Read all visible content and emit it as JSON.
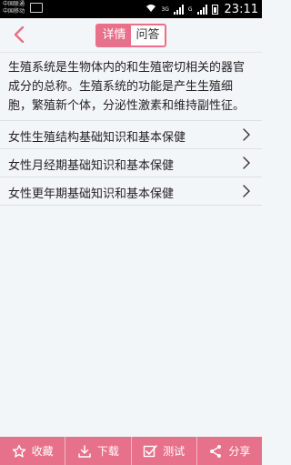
{
  "status_bar": {
    "carrier_line1": "中国联通",
    "carrier_line2": "中国移动",
    "network_type": "3G",
    "network_type_2": "G",
    "time": "23:11"
  },
  "header": {
    "back_icon": "chevron-left-icon",
    "tabs": [
      {
        "label": "详情",
        "active": true
      },
      {
        "label": "问答",
        "active": false
      }
    ]
  },
  "content": {
    "intro": "生殖系统是生物体内的和生殖密切相关的器官成分的总称。生殖系统的功能是产生生殖细胞，繁殖新个体，分泌性激素和维持副性征。"
  },
  "topics": [
    {
      "label": "女性生殖结构基础知识和基本保健"
    },
    {
      "label": "女性月经期基础知识和基本保健"
    },
    {
      "label": "女性更年期基础知识和基本保健"
    }
  ],
  "bottom_bar": {
    "favorite": "收藏",
    "download": "下载",
    "test": "测试",
    "share": "分享"
  },
  "colors": {
    "accent": "#e7708a",
    "background": "#f3f6f8"
  }
}
